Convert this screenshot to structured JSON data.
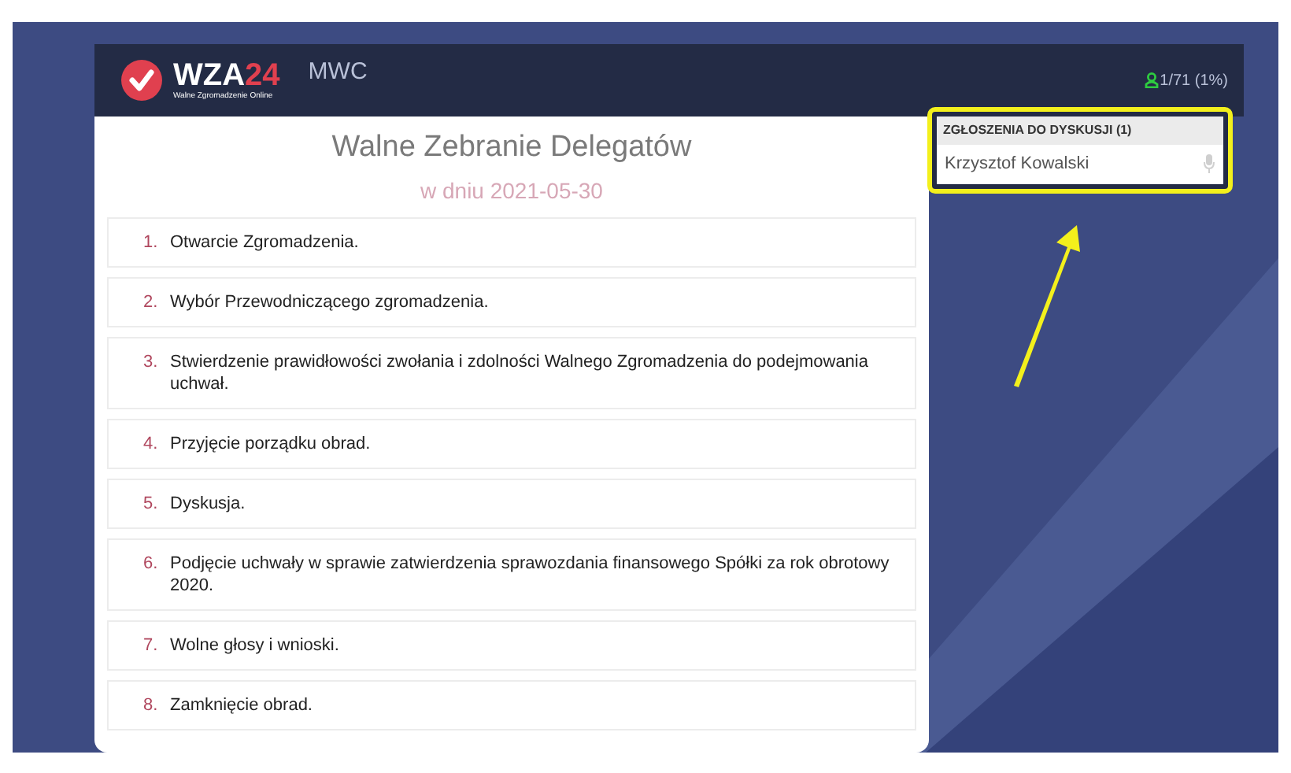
{
  "header": {
    "logo": {
      "main": "WZA",
      "accent": "24",
      "tagline": "Walne Zgromadzenie Online"
    },
    "company": "MWC",
    "attendance": "1/71 (1%)"
  },
  "agenda": {
    "title": "Walne Zebranie Delegatów",
    "date": "w dniu 2021-05-30",
    "items": [
      {
        "number": "1.",
        "text": "Otwarcie Zgromadzenia."
      },
      {
        "number": "2.",
        "text": "Wybór Przewodniczącego zgromadzenia."
      },
      {
        "number": "3.",
        "text": "Stwierdzenie prawidłowości zwołania i zdolności Walnego Zgromadzenia do podejmowania uchwał."
      },
      {
        "number": "4.",
        "text": "Przyjęcie porządku obrad."
      },
      {
        "number": "5.",
        "text": "Dyskusja."
      },
      {
        "number": "6.",
        "text": "Podjęcie uchwały w sprawie zatwierdzenia sprawozdania finansowego Spółki za rok obrotowy 2020."
      },
      {
        "number": "7.",
        "text": "Wolne głosy i wnioski."
      },
      {
        "number": "8.",
        "text": "Zamknięcie obrad."
      }
    ]
  },
  "discussion": {
    "title": "ZGŁOSZENIA DO DYSKUSJI (1)",
    "speakers": [
      {
        "name": "Krzysztof Kowalski"
      }
    ]
  }
}
